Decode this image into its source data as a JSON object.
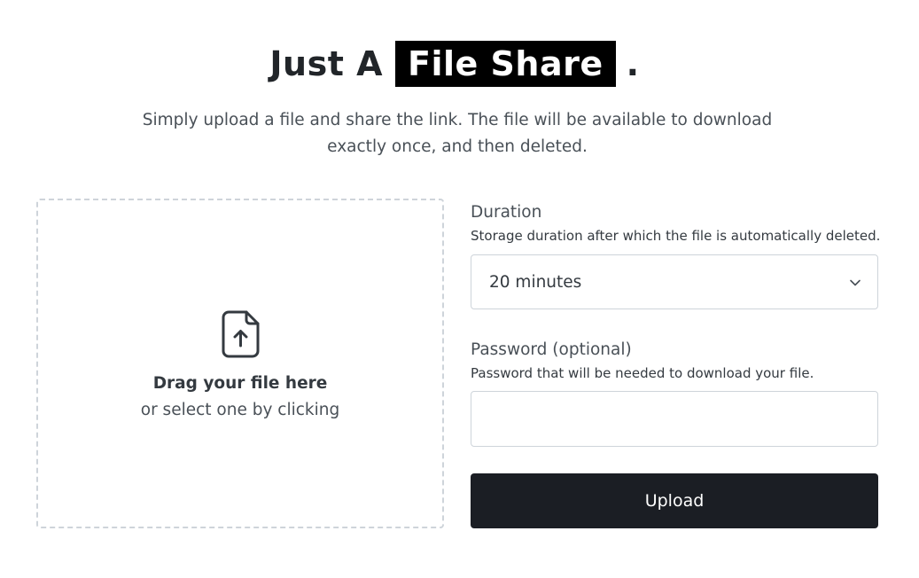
{
  "header": {
    "title_prefix": "Just A",
    "title_highlight": "File Share",
    "title_suffix": ".",
    "subtitle": "Simply upload a file and share the link. The file will be available to download exactly once, and then deleted."
  },
  "dropzone": {
    "icon": "file-upload-icon",
    "title": "Drag your file here",
    "subtitle": "or select one by clicking"
  },
  "form": {
    "duration": {
      "label": "Duration",
      "help": "Storage duration after which the file is automatically deleted.",
      "selected": "20 minutes",
      "icon": "chevron-down-icon"
    },
    "password": {
      "label": "Password (optional)",
      "help": "Password that will be needed to download your file.",
      "value": "",
      "placeholder": ""
    },
    "upload_label": "Upload"
  },
  "colors": {
    "highlight_bg": "#000000",
    "button_bg": "#1b1e24",
    "border": "#ced4da"
  }
}
